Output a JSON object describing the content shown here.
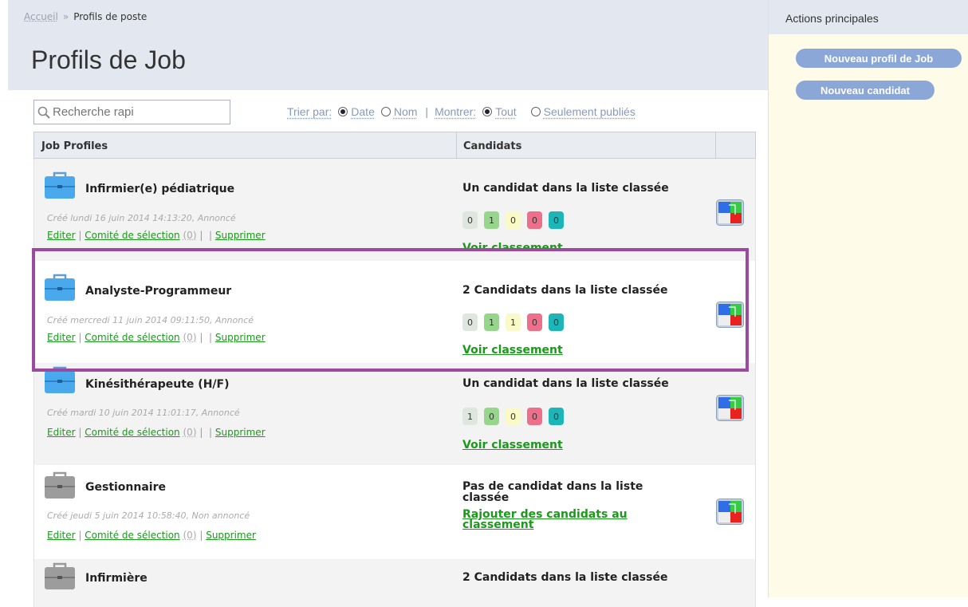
{
  "breadcrumb": {
    "home": "Accueil",
    "sep": "»",
    "current": "Profils de poste"
  },
  "page_title": "Profils de Job",
  "search": {
    "placeholder": "Recherche rapi"
  },
  "filters": {
    "sort_label": "Trier par:",
    "sort_date": "Date",
    "sort_name": "Nom",
    "separator": "|",
    "show_label": "Montrer:",
    "show_all": "Tout",
    "show_published": "Seulement publiés"
  },
  "table": {
    "col_profiles": "Job Profiles",
    "col_candidates": "Candidats"
  },
  "links": {
    "edit": "Editer",
    "committee": "Comité de sélection",
    "count": "(0)",
    "delete": "Supprimer",
    "sep": "|"
  },
  "rows": [
    {
      "name": "Infirmier(e) pédiatrique",
      "meta": "Créé lundi 16 juin 2014 14:13:20, Annoncé",
      "status": "Un candidat dans la liste classée",
      "chips": [
        "0",
        "1",
        "0",
        "0",
        "0"
      ],
      "link": "Voir classement"
    },
    {
      "name": "Analyste-Programmeur",
      "meta": "Créé mercredi 11 juin 2014 09:11:50, Annoncé",
      "status": "2 Candidats dans la liste classée",
      "chips": [
        "0",
        "1",
        "1",
        "0",
        "0"
      ],
      "link": "Voir classement"
    },
    {
      "name": "Kinésithérapeute (H/F)",
      "meta": "Créé mardi 10 juin 2014 11:01:17, Annoncé",
      "status": "Un candidat dans la liste classée",
      "chips": [
        "1",
        "0",
        "0",
        "0",
        "0"
      ],
      "link": "Voir classement"
    },
    {
      "name": "Gestionnaire",
      "meta": "Créé jeudi 5 juin 2014 10:58:40, Non annoncé",
      "status": "Pas de candidat dans la liste classée",
      "link": "Rajouter des candidats au classement"
    },
    {
      "name": "Infirmière",
      "status": "2 Candidats dans la liste classée"
    }
  ],
  "sidebar": {
    "title": "Actions principales",
    "new_profile": "Nouveau profil de Job",
    "new_candidate": "Nouveau candidat"
  },
  "colors": {
    "accent": "#8aa7d8",
    "link": "#1a9a1a",
    "highlight": "#9b4aa0"
  }
}
